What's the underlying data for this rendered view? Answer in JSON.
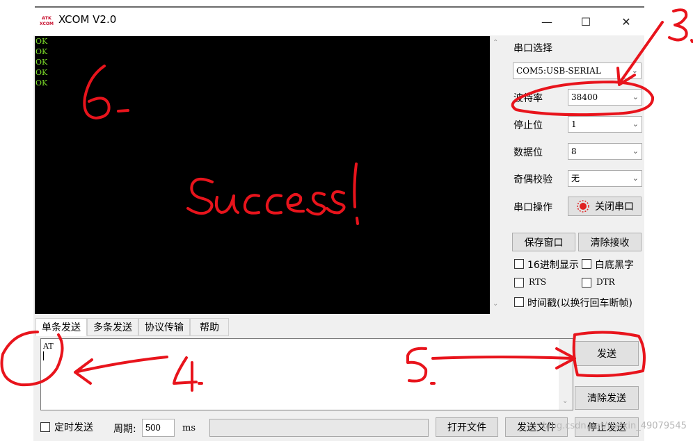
{
  "window": {
    "title": "XCOM V2.0",
    "logo_text_top": "ATK",
    "logo_text_bottom": "XCOM"
  },
  "receive": {
    "lines": [
      "OK",
      "OK",
      "OK",
      "OK",
      "OK"
    ]
  },
  "serial": {
    "port_label": "串口选择",
    "port_value": "COM5:USB-SERIAL",
    "baud_label": "波特率",
    "baud_value": "38400",
    "stopbits_label": "停止位",
    "stopbits_value": "1",
    "databits_label": "数据位",
    "databits_value": "8",
    "parity_label": "奇偶校验",
    "parity_value": "无",
    "operation_label": "串口操作",
    "close_port_button": "关闭串口",
    "save_window_button": "保存窗口",
    "clear_receive_button": "清除接收",
    "hex_display_label": "16进制显示",
    "white_bg_label": "白底黑字",
    "rts_label": "RTS",
    "dtr_label": "DTR",
    "timestamp_label": "时间戳(以换行回车断帧)"
  },
  "tabs": [
    "单条发送",
    "多条发送",
    "协议传输",
    "帮助"
  ],
  "send": {
    "text": "AT",
    "send_button": "发送",
    "clear_send_button": "清除发送"
  },
  "bottom": {
    "timed_send_label": "定时发送",
    "period_label": "周期:",
    "period_value": "500",
    "ms_label": "ms",
    "open_file_button": "打开文件",
    "send_file_button": "发送文件",
    "stop_send_button": "停止发送",
    "watermark": "blog.csdn.net/weixin_49079545"
  },
  "annotations": {
    "success": "Success!",
    "n3": "3.",
    "n4": "4.",
    "n5": "5.",
    "n6": "6.",
    "color": "#e8141c"
  }
}
